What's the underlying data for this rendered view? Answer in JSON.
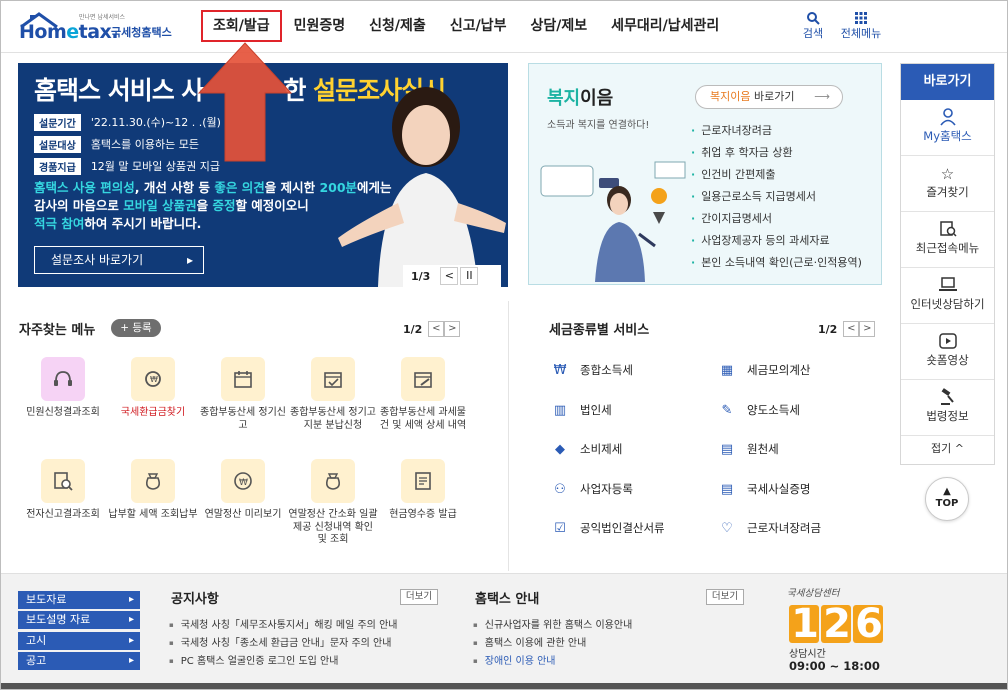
{
  "header": {
    "logo_small": "만나면 납세서비스",
    "logo_word_a": "Hom",
    "logo_word_e": "e",
    "logo_word_b": "tax.",
    "brand": "국세청홈택스",
    "nav": [
      "조회/발급",
      "민원증명",
      "신청/제출",
      "신고/납부",
      "상담/제보",
      "세무대리/납세관리"
    ],
    "active_nav": "조회/발급",
    "search_label": "검색",
    "menu_label": "전체메뉴"
  },
  "banner": {
    "title_plain": "홈택스 서비스 사",
    "title_mid": "한 ",
    "title_highlight": "설문조사실시",
    "rows": [
      {
        "tag": "설문기간",
        "value": "'22.11.30.(수)~12 . .(월)"
      },
      {
        "tag": "설문대상",
        "value": "홈택스를 이용하는 모든"
      },
      {
        "tag": "경품지급",
        "value": "12월 말 모바일 상품권 지급"
      }
    ],
    "desc_1a": "홈택스 사용 편의성",
    "desc_1b": ", 개선 사항 등 ",
    "desc_1c": "좋은 의견",
    "desc_1d": "을 제시한 ",
    "desc_1e": "200분",
    "desc_1f": "에게는",
    "desc_2a": "감사의 마음으로 ",
    "desc_2b": "모바일 상품권",
    "desc_2c": "을 ",
    "desc_2d": "증정",
    "desc_2e": "할 예정이오니",
    "desc_3a": "적극 참여",
    "desc_3b": "하여 주시기 바랍니다.",
    "button": "설문조사 바로가기",
    "pager": "1/3",
    "prev": "<",
    "pause": "II"
  },
  "welfare": {
    "title_a": "복지",
    "title_b": "이음",
    "subtitle": "소득과 복지를 연결하다!",
    "link_a": "복지이음",
    "link_b": " 바로가기",
    "items": [
      "근로자녀장려금",
      "취업 후 학자금 상환",
      "인건비 간편제출",
      "일용근로소득 지급명세서",
      "간이지급명세서",
      "사업장제공자 등의 과세자료",
      "본인 소득내역 확인(근로·인적용역)"
    ]
  },
  "quick": {
    "title": "바로가기",
    "items": [
      {
        "label": "My홈택스",
        "icon": "person-icon"
      },
      {
        "label": "즐겨찾기",
        "icon": "star-icon"
      },
      {
        "label": "최근접속메뉴",
        "icon": "recent-icon"
      },
      {
        "label": "인터넷상담하기",
        "icon": "laptop-icon"
      },
      {
        "label": "숏폼영상",
        "icon": "play-icon"
      },
      {
        "label": "법령정보",
        "icon": "gavel-icon"
      }
    ],
    "fold": "접기 ^",
    "top": "TOP"
  },
  "frequent": {
    "title": "자주찾는 메뉴",
    "add": "+ 등록",
    "page": "1/2",
    "prev": "<",
    "next": ">",
    "items": [
      {
        "label": "민원신청결과조회",
        "icon": "headset-icon",
        "red": false
      },
      {
        "label": "국세환급금찾기",
        "icon": "refund-icon",
        "red": true
      },
      {
        "label": "종합부동산세 정기신고",
        "icon": "calendar-icon",
        "red": false
      },
      {
        "label": "종합부동산세 정기고지분 분납신청",
        "icon": "calendar-check-icon",
        "red": false
      },
      {
        "label": "종합부동산세 과세물건 및 세액 상세 내역",
        "icon": "calendar-edit-icon",
        "red": false
      },
      {
        "label": "전자신고결과조회",
        "icon": "doc-search-icon",
        "red": false
      },
      {
        "label": "납부할 세액 조회납부",
        "icon": "money-bag-icon",
        "red": false
      },
      {
        "label": "연말정산 미리보기",
        "icon": "coin-icon",
        "red": false
      },
      {
        "label": "연말정산 간소화 일괄제공 신청내역 확인 및 조회",
        "icon": "money-bag-icon",
        "red": false
      },
      {
        "label": "현금영수증 발급",
        "icon": "receipt-icon",
        "red": false
      }
    ]
  },
  "taxservice": {
    "title": "세금종류별 서비스",
    "page": "1/2",
    "prev": "<",
    "next": ">",
    "items": [
      {
        "label": "종합소득세",
        "icon": "income-icon"
      },
      {
        "label": "세금모의계산",
        "icon": "calculator-icon"
      },
      {
        "label": "법인세",
        "icon": "building-icon"
      },
      {
        "label": "양도소득세",
        "icon": "transfer-icon"
      },
      {
        "label": "소비제세",
        "icon": "diamond-icon"
      },
      {
        "label": "원천세",
        "icon": "withholding-icon"
      },
      {
        "label": "사업자등록",
        "icon": "user-register-icon"
      },
      {
        "label": "국세사실증명",
        "icon": "certificate-icon"
      },
      {
        "label": "공익법인결산서류",
        "icon": "clipboard-icon"
      },
      {
        "label": "근로자녀장려금",
        "icon": "heart-hand-icon"
      }
    ]
  },
  "footer": {
    "press": [
      "보도자료",
      "보도설명 자료",
      "고시",
      "공고"
    ],
    "notice_title": "공지사항",
    "notice_more": "더보기",
    "notices": [
      "국세청 사칭「세무조사통지서」해킹 메일 주의 안내",
      "국세청 사칭「종소세 환급금 안내」문자 주의 안내",
      "PC 홈택스 얼굴인증 로그인 도입 안내"
    ],
    "guide_title": "홈택스 안내",
    "guide_more": "더보기",
    "guides": [
      "신규사업자를 위한 홈택스 이용안내",
      "홈택스 이용에 관한 안내",
      "장애인 이용 안내"
    ],
    "center_name": "국세상담센터",
    "center_digits": [
      "1",
      "2",
      "6"
    ],
    "hours_title": "상담시간",
    "hours": "09:00 ~ 18:00"
  },
  "colors": {
    "primary": "#2b5bb5",
    "banner_bg": "#103a78",
    "highlight_yellow": "#ffd230",
    "red_box": "#e0242a",
    "arrow": "#e5533a",
    "teal": "#1db3a3",
    "orange": "#f4a21a"
  }
}
